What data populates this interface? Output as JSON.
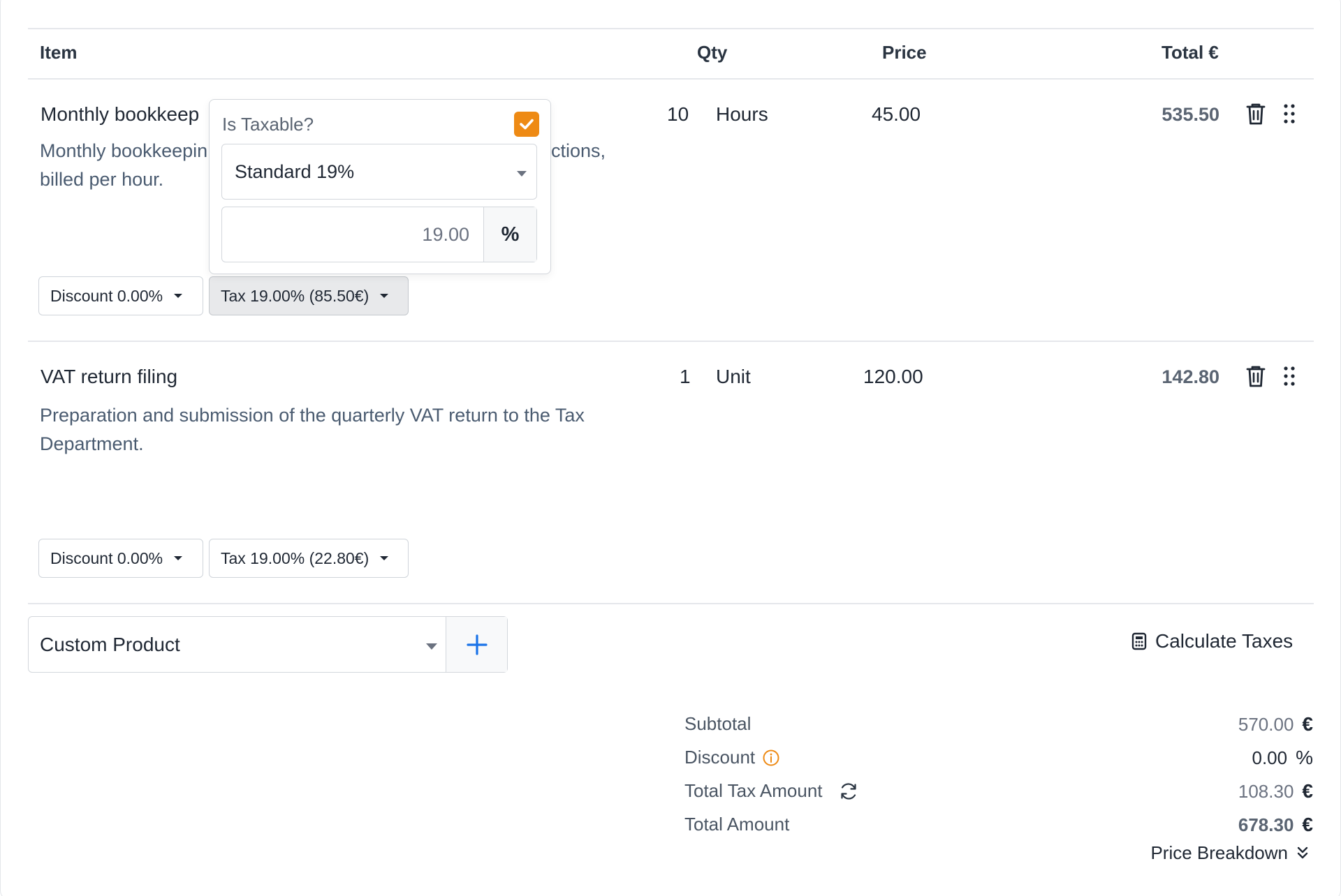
{
  "table": {
    "headers": {
      "item": "Item",
      "qty": "Qty",
      "price": "Price",
      "total": "Total €"
    }
  },
  "rows": [
    {
      "title": "Monthly bookkeep",
      "description_left": "Monthly bookkeepin",
      "description_right": "ctions,",
      "description_line2": "billed per hour.",
      "qty": "10",
      "unit": "Hours",
      "price": "45.00",
      "total": "535.50",
      "discount_label": "Discount 0.00%",
      "tax_label": "Tax 19.00% (85.50€)"
    },
    {
      "title": "VAT return filing",
      "description": "Preparation and submission of the quarterly VAT return to the Tax Department.",
      "qty": "1",
      "unit": "Unit",
      "price": "120.00",
      "total": "142.80",
      "discount_label": "Discount 0.00%",
      "tax_label": "Tax 19.00% (22.80€)"
    }
  ],
  "tax_popover": {
    "label": "Is Taxable?",
    "checked": true,
    "selected_rate": "Standard 19%",
    "rate_value": "19.00",
    "rate_unit": "%"
  },
  "add_product": {
    "selected": "Custom Product"
  },
  "calculate_taxes_label": "Calculate Taxes",
  "summary": {
    "subtotal_label": "Subtotal",
    "subtotal_value": "570.00",
    "discount_label": "Discount",
    "discount_value": "0.00",
    "discount_unit": "%",
    "tax_label": "Total Tax Amount",
    "tax_value": "108.30",
    "total_label": "Total Amount",
    "total_value": "678.30",
    "currency": "€"
  },
  "price_breakdown_label": "Price Breakdown",
  "colors": {
    "accent_orange": "#ee8a14",
    "accent_blue": "#1a73e8"
  }
}
